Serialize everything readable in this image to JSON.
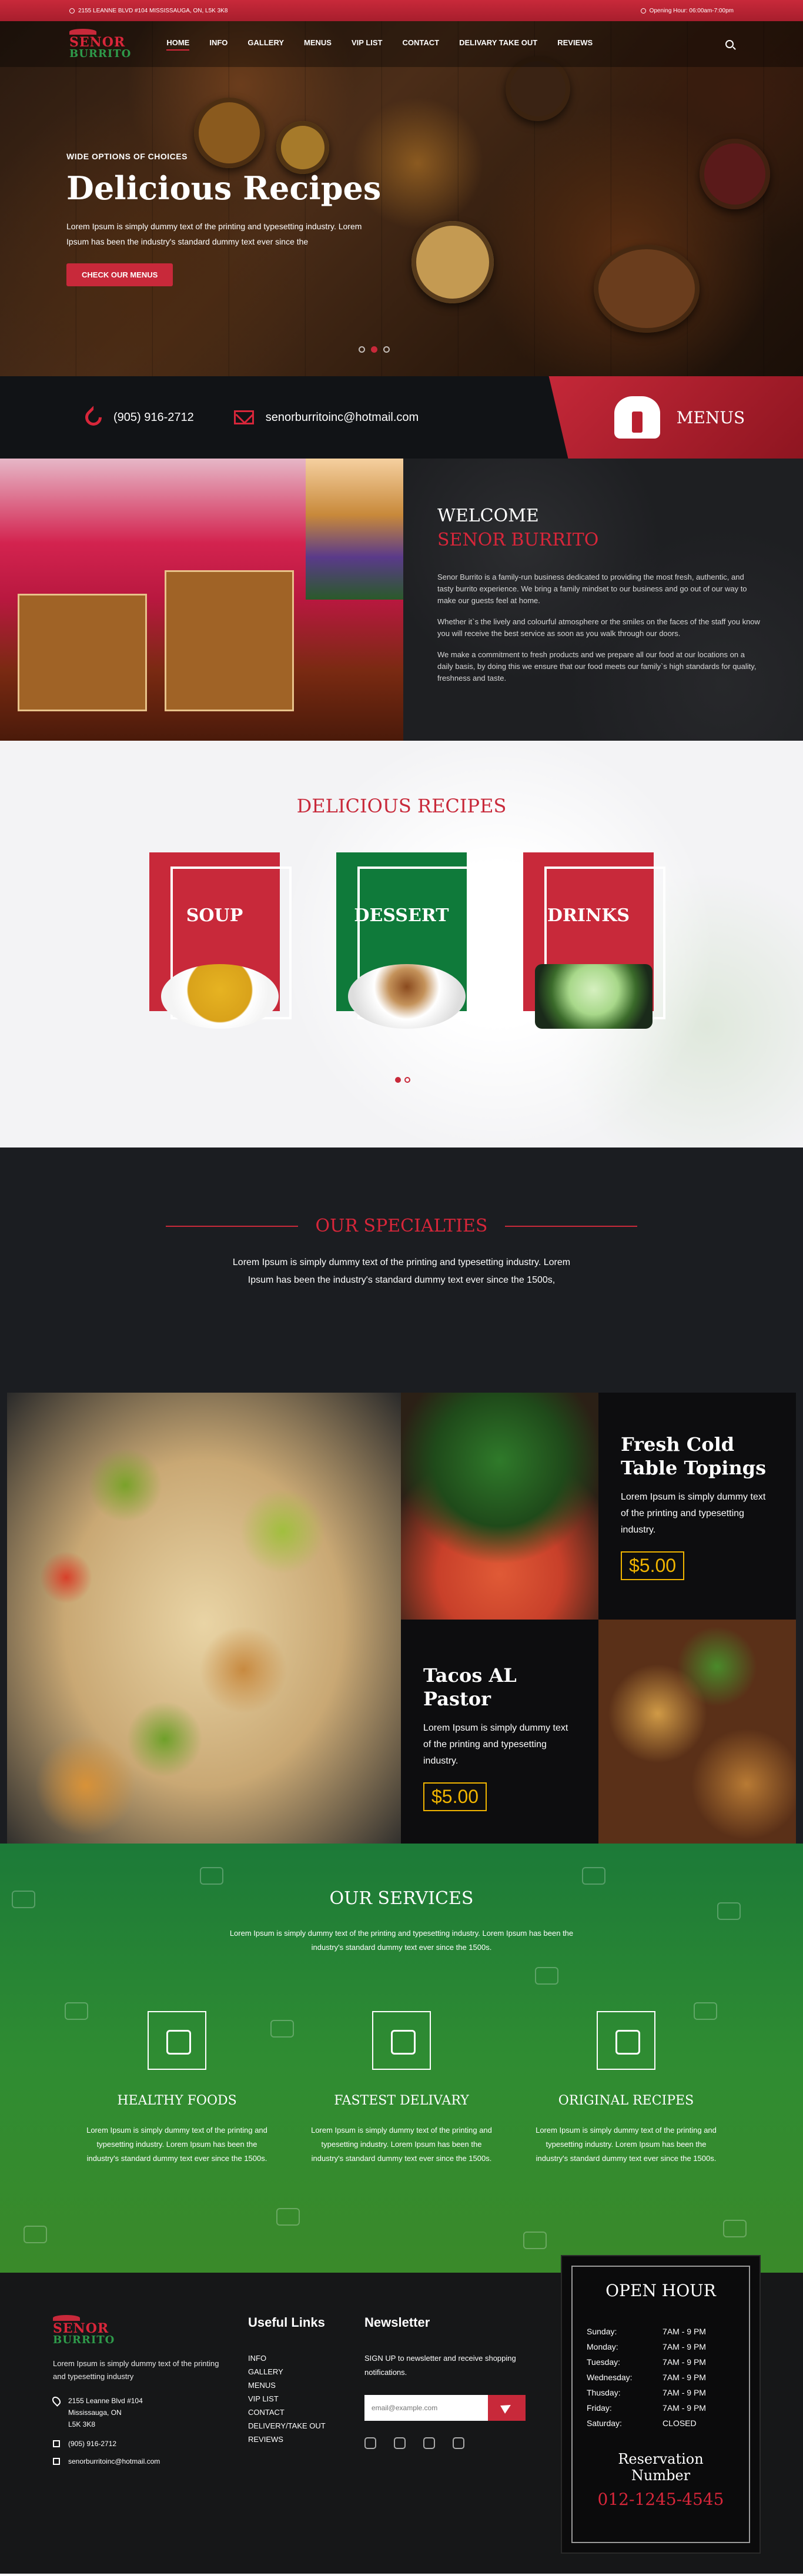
{
  "topbar": {
    "address": "2155 LEANNE BLVD #104 MISSISSAUGA, ON, L5K 3K8",
    "hours": "Opening Hour: 06:00am-7:00pm"
  },
  "logo": {
    "line1": "SENOR",
    "line2": "BURRITO"
  },
  "nav": {
    "items": [
      "HOME",
      "INFO",
      "GALLERY",
      "MENUS",
      "VIP LIST",
      "CONTACT",
      "DELIVARY TAKE OUT",
      "REVIEWS"
    ],
    "active": "HOME"
  },
  "hero": {
    "kicker": "WIDE OPTIONS OF CHOICES",
    "title": "Delicious Recipes",
    "text": "Lorem Ipsum is simply dummy text of the printing and typesetting industry. Lorem Ipsum has been the industry's standard dummy text ever since the",
    "button": "CHECK OUR MENUS"
  },
  "contact": {
    "phone": "(905) 916-2712",
    "email": "senorburritoinc@hotmail.com",
    "menus_label": "MENUS"
  },
  "welcome": {
    "title": "WELCOME",
    "subtitle": "SENOR BURRITO",
    "p1": "Senor Burrito is a family-run business dedicated to providing the most fresh, authentic, and tasty burrito experience. We bring a family mindset to our business and go out of our way to make our guests feel at home.",
    "p2": "Whether it`s the lively and colourful atmosphere or the smiles on the faces of the staff you know you will receive the best service as soon as you walk through our doors.",
    "p3": "We make a commitment to fresh products and we prepare all our food at our locations on a daily basis, by doing this we ensure that our food meets our family`s high standards for quality, freshness and taste."
  },
  "recipes": {
    "title": "DELICIOUS RECIPES",
    "cards": [
      {
        "title": "SOUP",
        "color": "#c8293a"
      },
      {
        "title": "DESSERT",
        "color": "#0f7a3a"
      },
      {
        "title": "DRINKS",
        "color": "#c8293a"
      }
    ]
  },
  "specialties": {
    "title": "OUR SPECIALTIES",
    "lead": "Lorem Ipsum is simply dummy text of the printing and typesetting industry. Lorem Ipsum has been the industry's standard dummy text ever since the 1500s,",
    "item1": {
      "title": "Fresh Cold Table Topings",
      "text": "Lorem Ipsum is simply dummy text of the printing and typesetting industry.",
      "price": "$5.00"
    },
    "item2": {
      "title": "Tacos AL Pastor",
      "text": "Lorem Ipsum is simply dummy text of the printing and typesetting industry.",
      "price": "$5.00"
    }
  },
  "services": {
    "title": "OUR SERVICES",
    "lead": "Lorem Ipsum is simply dummy text of the printing and typesetting industry. Lorem Ipsum has been the industry's standard dummy text ever since the 1500s.",
    "items": [
      {
        "title": "HEALTHY FOODS",
        "text": "Lorem Ipsum is simply dummy text of the printing and typesetting industry. Lorem Ipsum has been the industry's standard dummy text ever since the 1500s.",
        "icon": "salad-icon"
      },
      {
        "title": "FASTEST DELIVARY",
        "text": "Lorem Ipsum is simply dummy text of the printing and typesetting industry. Lorem Ipsum has been the industry's standard dummy text ever since the 1500s.",
        "icon": "delivery-truck-icon"
      },
      {
        "title": "ORIGINAL RECIPES",
        "text": "Lorem Ipsum is simply dummy text of the printing and typesetting industry. Lorem Ipsum has been the industry's standard dummy text ever since the 1500s.",
        "icon": "recipe-book-icon"
      }
    ]
  },
  "footer": {
    "about": "Lorem Ipsum is simply dummy text of the printing and typesetting industry",
    "address_line1": "2155 Leanne Blvd #104",
    "address_line2": "Mississauga, ON",
    "address_line3": "L5K 3K8",
    "phone": "(905) 916-2712",
    "email": "senorburritoinc@hotmail.com",
    "links_title": "Useful Links",
    "links": [
      "INFO",
      "GALLERY",
      "MENUS",
      "VIP LIST",
      "CONTACT",
      "DELIVERY/TAKE OUT",
      "REVIEWS"
    ],
    "newsletter_title": "Newsletter",
    "newsletter_text": "SIGN UP to newsletter and receive shopping notifications.",
    "newsletter_placeholder": "email@example.com",
    "hours_title": "OPEN HOUR",
    "hours": [
      {
        "day": "Sunday:",
        "time": "7AM - 9 PM"
      },
      {
        "day": "Monday:",
        "time": "7AM - 9 PM"
      },
      {
        "day": "Tuesday:",
        "time": "7AM - 9 PM"
      },
      {
        "day": "Wednesday:",
        "time": "7AM - 9 PM"
      },
      {
        "day": "Thusday:",
        "time": "7AM - 9 PM"
      },
      {
        "day": "Friday:",
        "time": "7AM - 9 PM"
      },
      {
        "day": "Saturday:",
        "time": "CLOSED"
      }
    ],
    "reservation_title": "Reservation Number",
    "reservation_number": "012-1245-4545"
  }
}
